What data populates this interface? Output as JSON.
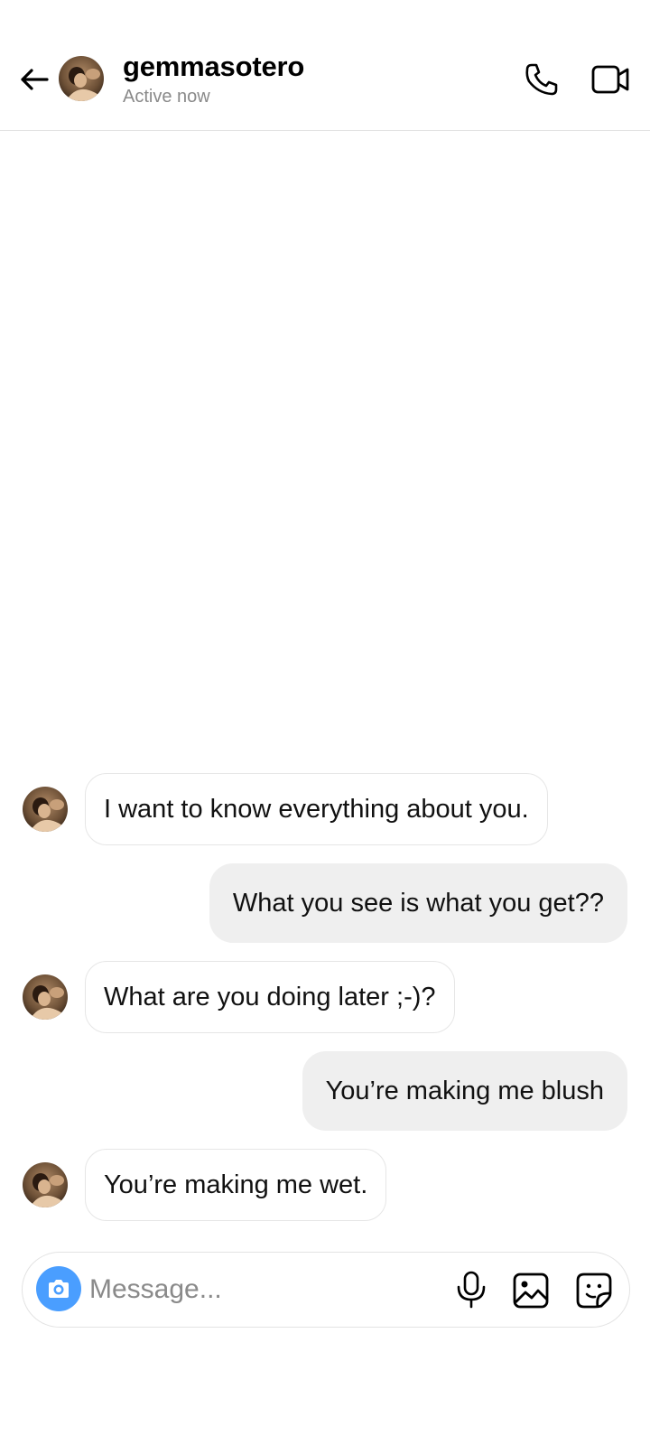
{
  "header": {
    "username": "gemmasotero",
    "status": "Active now"
  },
  "messages": [
    {
      "direction": "incoming",
      "text": "I want to know everything about you."
    },
    {
      "direction": "outgoing",
      "text": "What you see is what you get??"
    },
    {
      "direction": "incoming",
      "text": "What are you doing later ;-)?"
    },
    {
      "direction": "outgoing",
      "text": "You’re making me blush"
    },
    {
      "direction": "incoming",
      "text": "You’re making me wet."
    }
  ],
  "composer": {
    "placeholder": "Message..."
  },
  "icons": {
    "back": "arrow-left-icon",
    "call": "phone-icon",
    "video": "video-camera-icon",
    "camera": "camera-icon",
    "mic": "microphone-icon",
    "gallery": "image-icon",
    "sticker": "sticker-icon"
  },
  "colors": {
    "camera_button": "#4a9eff",
    "outgoing_bubble": "#efefef",
    "incoming_bubble_border": "#e6e6e6",
    "secondary_text": "#8a8a8a"
  }
}
